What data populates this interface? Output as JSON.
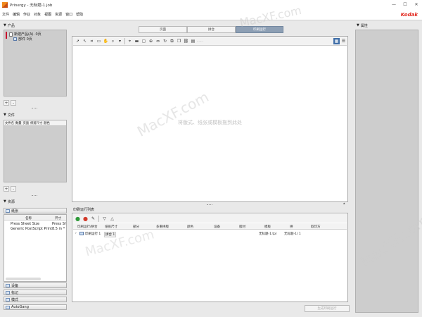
{
  "window": {
    "title": "Prinergy - 无标题-1.job",
    "minimize_glyph": "—",
    "maximize_glyph": "☐",
    "close_glyph": "✕"
  },
  "menu": [
    "文件",
    "编辑",
    "作业",
    "对象",
    "视图",
    "资源",
    "窗口",
    "帮助"
  ],
  "brand": {
    "name": "Kodak",
    "color": "#e1261c"
  },
  "watermark": "MacXF.com",
  "products_panel": {
    "title": "产品",
    "tree": [
      {
        "label": "新建产品(A). 0页"
      },
      {
        "label": "部件 0页"
      }
    ],
    "add_glyph": "+",
    "remove_glyph": "-"
  },
  "files_panel": {
    "title": "文件",
    "columns": [
      "文件名",
      "数量",
      "页面",
      "修剪尺寸",
      "颜色"
    ],
    "add_glyph": "+",
    "remove_glyph": "-"
  },
  "resources_panel": {
    "title": "资源",
    "sheets_tab": "纸张",
    "columns": [
      "名称",
      "尺寸"
    ],
    "rows": [
      {
        "name": "Press Sheet Size",
        "size": "Press Sh"
      },
      {
        "name": "Generic PostScript Printer",
        "size": "8.5 in * 1"
      }
    ],
    "other_tabs": [
      "设备",
      "标记",
      "模式",
      "AutoGang"
    ]
  },
  "view_tabs": {
    "items": [
      "页面",
      "拼合",
      "印刷运行"
    ],
    "active_index": 2
  },
  "canvas": {
    "hint": "将版式、纸张或模板拖到此处"
  },
  "press_runs": {
    "title": "印刷运行列表",
    "columns": [
      "印刷运行/拼合",
      "纸张尺寸",
      "部分",
      "多重拼版",
      "颜色",
      "设备",
      "版材",
      "模板",
      "拼",
      "取印方"
    ],
    "row": {
      "name": "印刷运行 1",
      "badge": "拼合 1",
      "template": "无标题-1.tpl",
      "plate": "无标题-1/ 1"
    }
  },
  "footer": {
    "create_button": "生成印刷运行"
  },
  "properties_panel": {
    "title": "属性"
  }
}
